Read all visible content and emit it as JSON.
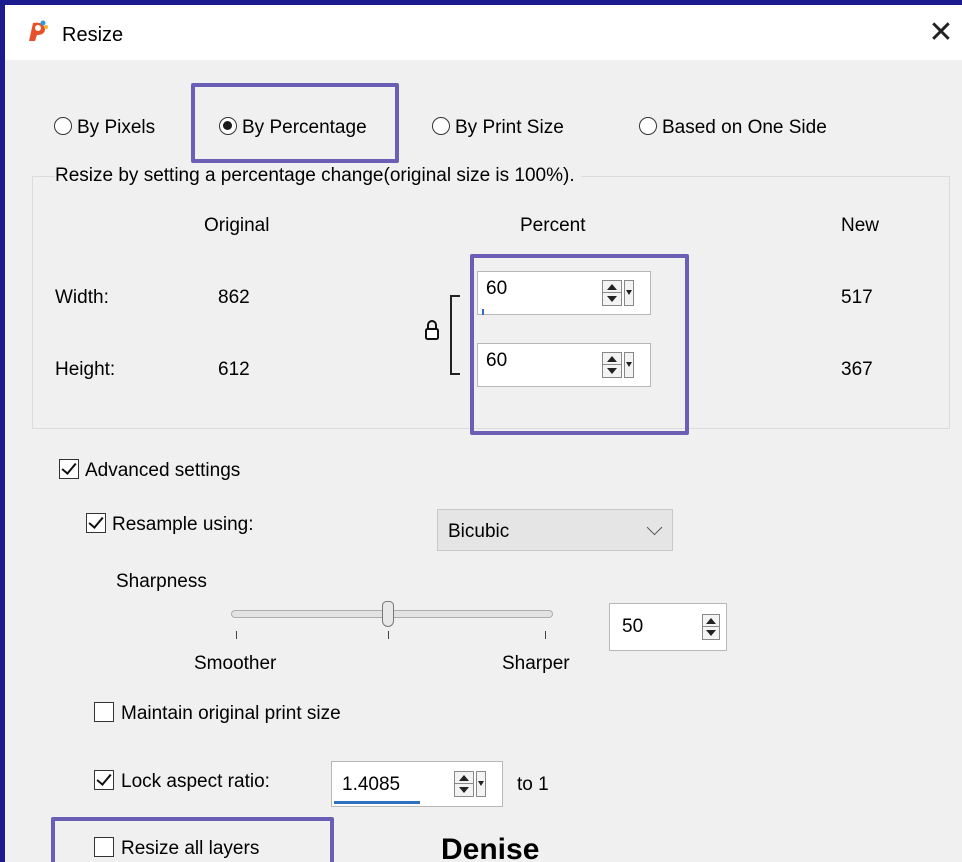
{
  "window": {
    "title": "Resize",
    "close_glyph": "✕"
  },
  "mode_options": [
    {
      "label": "By Pixels",
      "selected": false
    },
    {
      "label": "By Percentage",
      "selected": true
    },
    {
      "label": "By Print Size",
      "selected": false
    },
    {
      "label": "Based on One Side",
      "selected": false
    }
  ],
  "percent_group": {
    "caption": "Resize by setting a percentage change(original size is 100%).",
    "col_original": "Original",
    "col_percent": "Percent",
    "col_new": "New",
    "width": {
      "label": "Width:",
      "original": "862",
      "percent": "60",
      "new": "517"
    },
    "height": {
      "label": "Height:",
      "original": "612",
      "percent": "60",
      "new": "367"
    }
  },
  "advanced": {
    "label": "Advanced settings",
    "checked": true,
    "resample": {
      "label": "Resample using:",
      "checked": true,
      "method": "Bicubic"
    },
    "sharpness": {
      "label": "Sharpness",
      "value": "50",
      "left_label": "Smoother",
      "right_label": "Sharper"
    },
    "maintain_print": {
      "label": "Maintain original print size",
      "checked": false
    },
    "lock_aspect": {
      "label": "Lock aspect ratio:",
      "checked": true,
      "value": "1.4085",
      "suffix": "to 1"
    },
    "resize_layers": {
      "label": "Resize all layers",
      "checked": false
    }
  },
  "watermark": "Denise",
  "colors": {
    "highlight": "#6a5fb5",
    "focus": "#2f6fc4",
    "frame": "#1b1b8f"
  },
  "icons": [
    "app-icon",
    "close-icon",
    "lock-icon",
    "spin-arrows-icon",
    "dropdown-arrow-icon",
    "chevron-down-icon"
  ]
}
